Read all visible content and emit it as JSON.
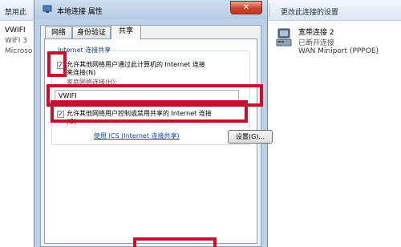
{
  "background_window": {
    "toolbar": {
      "left_label": "禁用此",
      "right_label": "更改此连接的设置"
    },
    "vwifi_connection": {
      "name": "VWIFI",
      "subtitle": "WIFI 3",
      "device": "Microso"
    },
    "broadband_connection": {
      "icon": "network-adapter-icon",
      "name": "宽带连接 2",
      "status": "已断开连接",
      "device": "WAN Miniport (PPPOE)"
    }
  },
  "dialog": {
    "title": "本地连接 属性",
    "title_icon": "network-icon",
    "close_label": "✕",
    "tabs": [
      {
        "label": "网络",
        "active": false
      },
      {
        "label": "身份验证",
        "active": false
      },
      {
        "label": "共享",
        "active": true
      }
    ],
    "group_title": "Internet 连接共享",
    "allow_share": {
      "checked": true,
      "line1": "允许其他网络用户通过此计算机的 Internet 连接",
      "line2": "来连接(N)"
    },
    "home_connection": {
      "label": "家庭网络连接(H):",
      "value": "VWIFI"
    },
    "allow_control": {
      "checked": true,
      "line1": "允许其他网络用户控制或禁用共享的 Internet 连接",
      "line2": "(O)"
    },
    "ics_link": "使用 ICS (Internet 连接共享)",
    "settings_button": "设置(G)..."
  },
  "colors": {
    "highlight": "#c8102e",
    "dialog_frame": "#bcd0e6",
    "link": "#0b4fb3"
  }
}
